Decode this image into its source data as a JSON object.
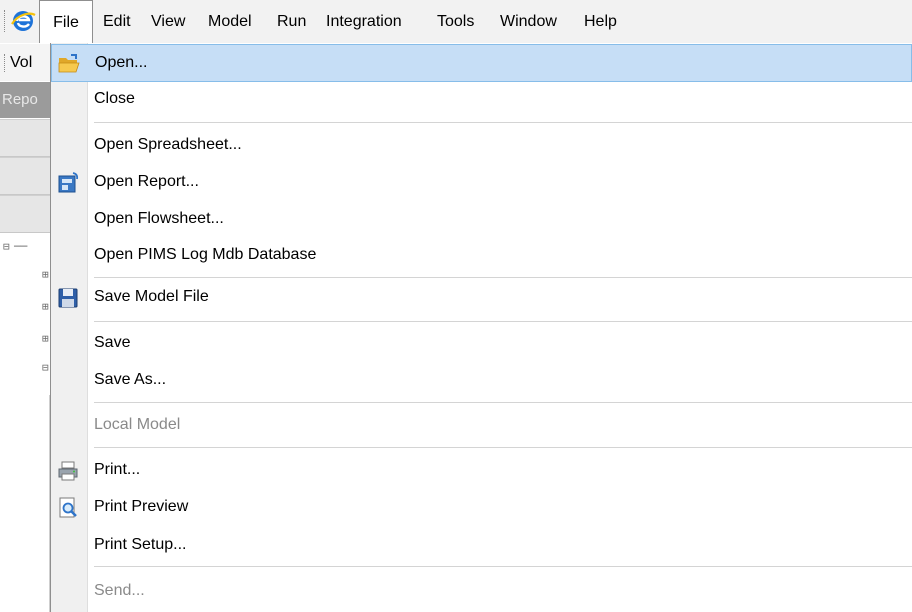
{
  "menubar": {
    "app_icon": "app-logo-icon",
    "items": [
      {
        "label": "File",
        "active": true
      },
      {
        "label": "Edit"
      },
      {
        "label": "View"
      },
      {
        "label": "Model"
      },
      {
        "label": "Run"
      },
      {
        "label": "Integration"
      },
      {
        "label": "Tools"
      },
      {
        "label": "Window"
      },
      {
        "label": "Help"
      }
    ]
  },
  "background": {
    "toolbar_text": "Vol",
    "panel_header": "Repo"
  },
  "file_menu": {
    "items": [
      {
        "label": "Open...",
        "icon": "folder-open-icon",
        "highlighted": true
      },
      {
        "label": "Close"
      },
      {
        "label": "Open Spreadsheet..."
      },
      {
        "label": "Open Report...",
        "icon": "report-icon"
      },
      {
        "label": "Open Flowsheet..."
      },
      {
        "label": "Open PIMS Log Mdb Database"
      },
      {
        "label": "Save Model File",
        "icon": "floppy-disk-icon"
      },
      {
        "label": "Save"
      },
      {
        "label": "Save As..."
      },
      {
        "label": "Local Model",
        "disabled": true
      },
      {
        "label": "Print...",
        "icon": "printer-icon"
      },
      {
        "label": "Print Preview",
        "icon": "print-preview-icon"
      },
      {
        "label": "Print Setup..."
      },
      {
        "label": "Send...",
        "disabled": true
      }
    ]
  },
  "colors": {
    "highlight_fill": "#c6def6",
    "highlight_border": "#87bde9",
    "disabled_text": "#8a8a8a"
  }
}
